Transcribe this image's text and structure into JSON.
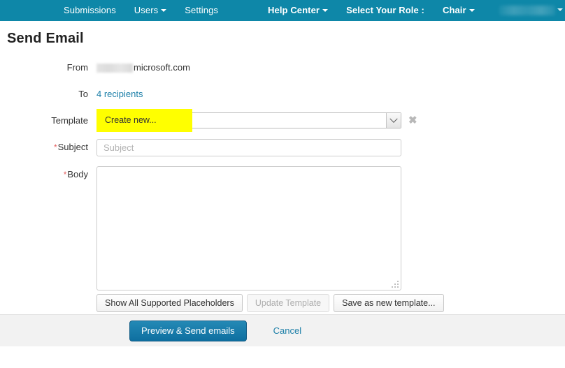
{
  "navbar": {
    "background_color": "#0e87a8",
    "left_items": [
      {
        "label": "Submissions",
        "caret": false
      },
      {
        "label": "Users",
        "caret": true
      },
      {
        "label": "Settings",
        "caret": false
      }
    ],
    "right_items": [
      {
        "label": "Help Center",
        "caret": true,
        "bold": true
      },
      {
        "label": "Select Your Role :",
        "caret": false,
        "bold": true
      },
      {
        "label": "Chair",
        "caret": true,
        "bold": true
      }
    ],
    "redacted_items": [
      "",
      ""
    ]
  },
  "page": {
    "title": "Send Email"
  },
  "form": {
    "from": {
      "label": "From",
      "redacted_prefix": "",
      "domain": "microsoft.com"
    },
    "to": {
      "label": "To",
      "recipients_link": "4 recipients"
    },
    "template": {
      "label": "Template",
      "value": "Create new...",
      "highlight_color": "#ffff00",
      "clear_icon": "✖"
    },
    "subject": {
      "label": "Subject",
      "required_marker": "*",
      "value": "",
      "placeholder": "Subject"
    },
    "body": {
      "label": "Body",
      "required_marker": "*",
      "value": "",
      "placeholder": ""
    }
  },
  "template_actions": {
    "show_placeholders": "Show All Supported Placeholders",
    "update_template": "Update Template",
    "save_as_new": "Save as new template..."
  },
  "footer": {
    "primary_button": "Preview & Send emails",
    "cancel_link": "Cancel",
    "primary_color": "#0e6fa0"
  }
}
